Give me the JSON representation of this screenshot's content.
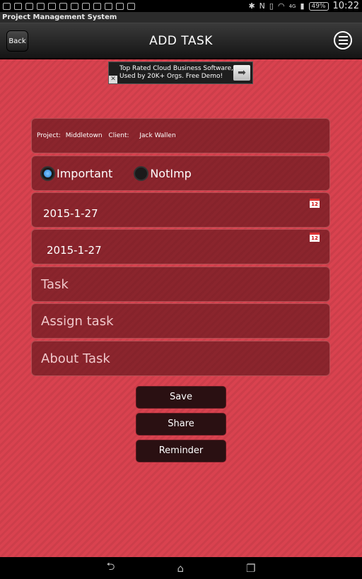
{
  "status_bar": {
    "battery": "49%",
    "time": "10:22",
    "network": "4G"
  },
  "app_title": "Project Management System",
  "header": {
    "back_label": "Back",
    "title": "ADD TASK"
  },
  "ad": {
    "line1": "Top Rated Cloud Business Software,",
    "line2": "Used by 20K+ Orgs. Free Demo!",
    "close": "✕",
    "arrow": "➡"
  },
  "project_info": {
    "project_label": "Project:",
    "project_value": "Middletown",
    "client_label": "Client:",
    "client_value": "Jack Wallen"
  },
  "priority": {
    "options": [
      {
        "label": "Important",
        "checked": true
      },
      {
        "label": "NotImp",
        "checked": false
      }
    ]
  },
  "dates": {
    "start": "2015-1-27",
    "end": "2015-1-27",
    "calendar_icon_text": "12"
  },
  "fields": {
    "task_placeholder": "Task",
    "assign_placeholder": "Assign task",
    "about_placeholder": "About Task"
  },
  "buttons": {
    "save": "Save",
    "share": "Share",
    "reminder": "Reminder"
  },
  "navbar": {
    "back_icon": "⮌",
    "home_icon": "⌂",
    "recents_icon": "❐"
  },
  "colors": {
    "background": "#d9424f",
    "field": "#5a1419",
    "button": "#2a1012",
    "radio_checked": "#2a84d8"
  }
}
